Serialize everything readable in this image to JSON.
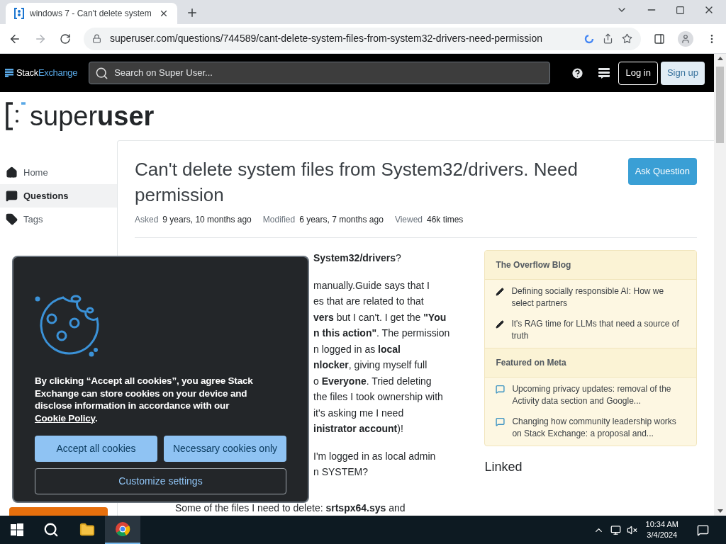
{
  "browser": {
    "tab_title": "windows 7 - Can't delete system",
    "url": "superuser.com/questions/744589/cant-delete-system-files-from-system32-drivers-need-permission"
  },
  "topbar": {
    "brand_first": "Stack",
    "brand_second": "Exchange",
    "search": {
      "placeholder": "Search on Super User..."
    },
    "login": "Log in",
    "signup": "Sign up"
  },
  "site_logo": {
    "first": "super",
    "second": "user"
  },
  "nav": [
    {
      "label": "Home",
      "kind": "home",
      "selected": false
    },
    {
      "label": "Questions",
      "kind": "questions",
      "selected": true
    },
    {
      "label": "Tags",
      "kind": "tags",
      "selected": false
    }
  ],
  "question": {
    "title": "Can't delete system files from System32/drivers. Need permission",
    "ask_button": "Ask Question",
    "meta": [
      {
        "label": "Asked",
        "value": "9 years, 10 months ago"
      },
      {
        "label": "Modified",
        "value": "6 years, 7 months ago"
      },
      {
        "label": "Viewed",
        "value": "46k times"
      }
    ],
    "body_fragments": [
      [
        "**System32/drivers**?"
      ],
      [
        "manually.Guide says that I",
        "es that are related to that",
        "**vers** but I can't. I get the **\"You**",
        "**n this action\"**. The permission",
        "n logged in as **local**",
        "**nlocker**, giving myself full",
        "o **Everyone**. Tried deleting",
        "the files I took ownership with",
        "it's asking me I need",
        "**inistrator account**)!"
      ],
      [
        "I'm logged in as local admin",
        "n SYSTEM?"
      ]
    ],
    "body_below_dialog": "Some of the files I need to delete: **srtspx64.sys** and"
  },
  "widgets": [
    {
      "heading": "The Overflow Blog",
      "items": [
        {
          "kind": "blog",
          "text": "Defining socially responsible AI: How we select partners"
        },
        {
          "kind": "blog",
          "text": "It's RAG time for LLMs that need a source of truth"
        }
      ]
    },
    {
      "heading": "Featured on Meta",
      "items": [
        {
          "kind": "meta",
          "text": "Upcoming privacy updates: removal of the Activity data section and Google..."
        },
        {
          "kind": "meta",
          "text": "Changing how community leadership works on Stack Exchange: a proposal and..."
        }
      ]
    }
  ],
  "linked_heading": "Linked",
  "cookie_dialog": {
    "text_before": "By clicking “Accept all cookies”, you agree Stack Exchange can store cookies on your device and disclose information in accordance with our",
    "link": "Cookie Policy",
    "text_after": ".",
    "buttons": [
      {
        "label": "Accept all cookies",
        "kind": "primary"
      },
      {
        "label": "Necessary cookies only",
        "kind": "primary"
      },
      {
        "label": "Customize settings",
        "kind": "outline"
      }
    ]
  },
  "taskbar": {
    "apps": [
      {
        "kind": "explorer",
        "selected": false
      },
      {
        "kind": "chrome",
        "selected": true
      }
    ],
    "time": "10:34 AM",
    "date": "3/4/2024"
  }
}
